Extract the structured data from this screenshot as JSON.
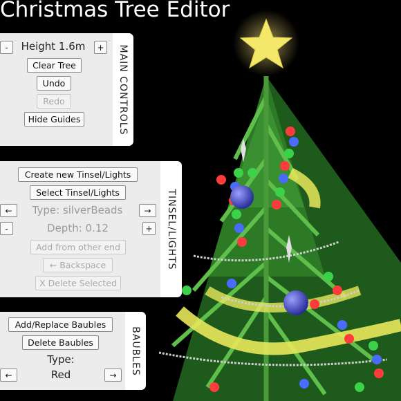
{
  "app_title": "Christmas Tree Editor",
  "main_controls": {
    "tab_label": "MAIN CONTROLS",
    "height_decrease_label": "-",
    "height_text": "Height 1.6m",
    "height_increase_label": "+",
    "clear_tree_label": "Clear Tree",
    "undo_label": "Undo",
    "redo_label": "Redo",
    "hide_guides_label": "Hide Guides"
  },
  "tinsel_lights": {
    "tab_label": "TINSEL/LIGHTS",
    "create_new_label": "Create new Tinsel/Lights",
    "select_label": "Select Tinsel/Lights",
    "type_prev_label": "←",
    "type_text": "Type: silverBeads",
    "type_next_label": "→",
    "depth_decrease_label": "-",
    "depth_text": "Depth: 0.12",
    "depth_increase_label": "+",
    "add_from_other_end_label": "Add from other end",
    "backspace_label": "← Backspace",
    "delete_selected_label": "X Delete Selected"
  },
  "baubles": {
    "tab_label": "BAUBLES",
    "add_replace_label": "Add/Replace Baubles",
    "delete_label": "Delete Baubles",
    "type_label": "Type:",
    "type_prev_label": "←",
    "type_value": "Red",
    "type_next_label": "→"
  },
  "scene_colors": {
    "background": "#000000",
    "branch": "#3f9e35",
    "star": "#f3e86a",
    "bauble": "#4a4fc4",
    "tinsel": "#e8e85a",
    "lights": [
      "#ff3b3b",
      "#3bd24a",
      "#4a6bff",
      "#ffd84a"
    ]
  }
}
